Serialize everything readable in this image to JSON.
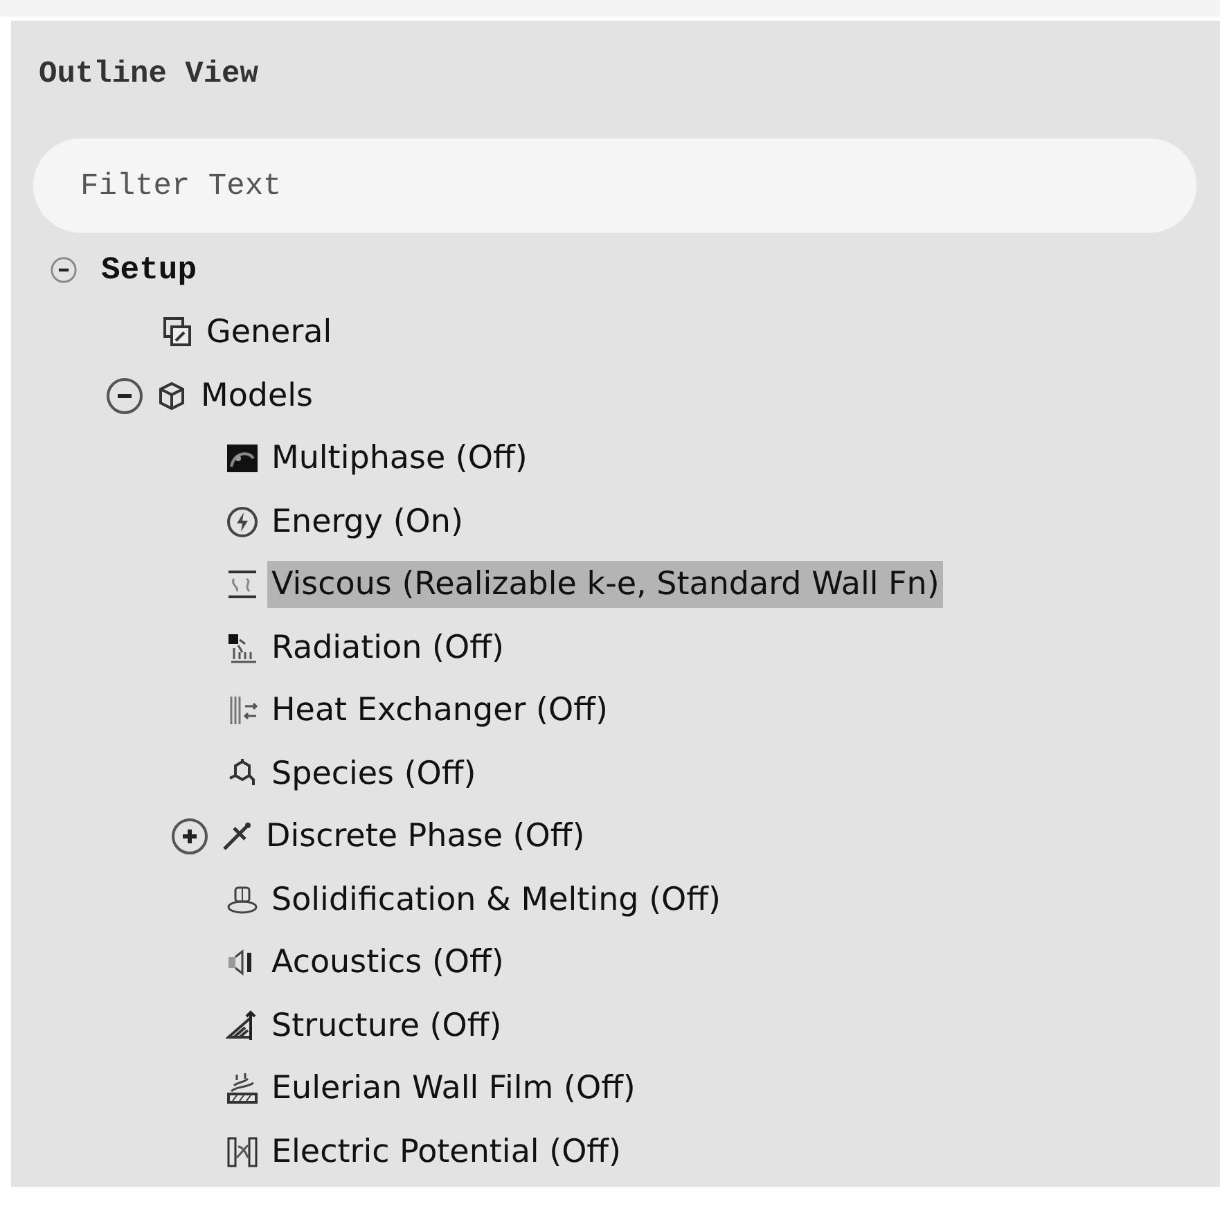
{
  "panel": {
    "title": "Outline View"
  },
  "filter": {
    "placeholder": "Filter Text"
  },
  "tree": [
    {
      "label": "Setup",
      "expanded": true,
      "selected": false,
      "children": [
        {
          "label": "General",
          "selected": false
        },
        {
          "label": "Models",
          "expanded": true,
          "selected": false,
          "children": [
            {
              "label": "Multiphase (Off)",
              "selected": false
            },
            {
              "label": "Energy (On)",
              "selected": false
            },
            {
              "label": "Viscous (Realizable k-e, Standard Wall Fn)",
              "selected": true
            },
            {
              "label": "Radiation (Off)",
              "selected": false
            },
            {
              "label": "Heat Exchanger (Off)",
              "selected": false
            },
            {
              "label": "Species (Off)",
              "selected": false
            },
            {
              "label": "Discrete Phase (Off)",
              "expanded": false,
              "selected": false
            },
            {
              "label": "Solidification & Melting (Off)",
              "selected": false
            },
            {
              "label": "Acoustics (Off)",
              "selected": false
            },
            {
              "label": "Structure (Off)",
              "selected": false
            },
            {
              "label": "Eulerian Wall Film (Off)",
              "selected": false
            },
            {
              "label": "Electric Potential (Off)",
              "selected": false
            }
          ]
        }
      ]
    }
  ]
}
